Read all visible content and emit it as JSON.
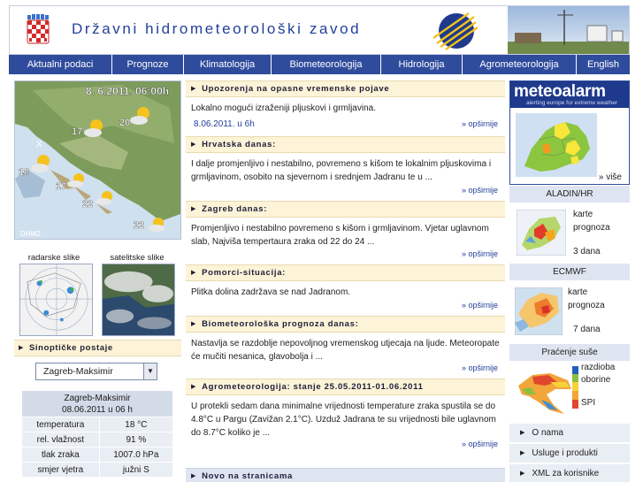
{
  "header": {
    "title": "Državni hidrometeorološki zavod"
  },
  "nav": [
    "Aktualni podaci",
    "Prognoze",
    "Klimatologija",
    "Biometeorologija",
    "Hidrologija",
    "Agrometeorologija",
    "English"
  ],
  "weather_map": {
    "datetime": "8. 6.2011. 06:00h",
    "temperatures": [
      "20",
      "17",
      "18",
      "17",
      "22",
      "22"
    ],
    "station_letter": "X",
    "watermark": "DHMZ"
  },
  "thumbs": {
    "radar_label": "radarske slike",
    "satellite_label": "satelitske slike"
  },
  "stations": {
    "header": "Sinoptičke postaje",
    "selected": "Zagreb-Maksimir",
    "table_title": "Zagreb-Maksimir",
    "table_time": "08.06.2011 u 06 h",
    "rows": [
      {
        "label": "temperatura",
        "value": "18 °C"
      },
      {
        "label": "rel. vlažnost",
        "value": "91 %"
      },
      {
        "label": "tlak zraka",
        "value": "1007.0 hPa"
      },
      {
        "label": "smjer vjetra",
        "value": "južni S"
      }
    ]
  },
  "sections": {
    "warnings": {
      "title": "Upozorenja na opasne vremenske pojave",
      "text": "Lokalno mogući izraženiji pljuskovi i grmljavina.",
      "date": "8.06.2011. u 6h",
      "more": "» opširnije"
    },
    "croatia": {
      "title": "Hrvatska danas:",
      "text": "I dalje promjenljivo i nestabilno, povremeno s kišom te lokalnim pljuskovima i grmljavinom, osobito na sjevernom i srednjem Jadranu te u ...",
      "more": "» opširnije"
    },
    "zagreb": {
      "title": "Zagreb danas:",
      "text": "Promjenljivo i nestabilno povremeno s kišom i grmljavinom. Vjetar uglavnom slab, Najviša tempertaura zraka od 22 do 24 ...",
      "more": "» opširnije"
    },
    "sailors": {
      "title": "Pomorci-situacija:",
      "text": "Plitka dolina zadržava se nad Jadranom.",
      "more": "» opširnije"
    },
    "bio": {
      "title": "Biometeorološka prognoza danas:",
      "text": "Nastavlja se razdoblje nepovoljnog vremenskog utjecaja na ljude. Meteoropate će mučiti nesanica, glavobolja i ...",
      "more": "» opširnije"
    },
    "agro": {
      "title": "Agrometeorologija: stanje 25.05.2011-01.06.2011",
      "text": "U protekli sedam dana minimalne vrijednosti temperature zraka spustila se do 4.8°C u Pargu (Zavižan 2.1°C). Uzduž Jadrana te su vrijednosti bile uglavnom do 8.7°C koliko je ...",
      "more": "» opširnije"
    },
    "news": {
      "title": "Novo na stranicama"
    }
  },
  "right": {
    "meteoalarm_word": "meteoalarm",
    "meteoalarm_sub": "alerting europe for extreme weather",
    "meteoalarm_more": "» više",
    "aladin": {
      "title": "ALADIN/HR",
      "line1": "karte",
      "line2": "prognoza",
      "line3": "3 dana"
    },
    "ecmwf": {
      "title": "ECMWF",
      "line1": "karte",
      "line2": "prognoza",
      "line3": "7 dana"
    },
    "drought": {
      "title": "Praćenje suše",
      "line1": "razdioba",
      "line2": "oborine",
      "line3": "SPI"
    },
    "links": [
      "O nama",
      "Usluge i produkti",
      "XML za korisnike"
    ]
  },
  "colors": {
    "nav_bg": "#2f4b9c",
    "section_bg": "#fdf3d7",
    "link": "#23409a"
  }
}
